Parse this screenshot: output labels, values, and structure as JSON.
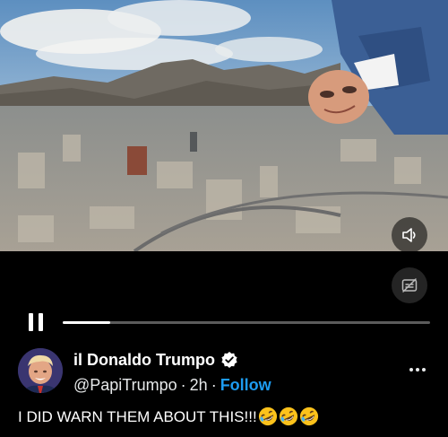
{
  "video": {
    "sound_icon": "speaker-icon",
    "captions_icon": "captions-off-icon",
    "progress_fraction": 0.13
  },
  "controls": {
    "pause_icon": "pause-icon"
  },
  "post": {
    "display_name": "il Donaldo Trumpo",
    "verified_icon": "verified-badge-icon",
    "handle": "@PapiTrumpo",
    "separator": "·",
    "time": "2h",
    "follow_label": "Follow",
    "more_icon": "more-options-icon",
    "text": "I DID WARN THEM ABOUT THIS!!!",
    "emoji": [
      "rofl-emoji",
      "rofl-emoji",
      "rofl-emoji"
    ]
  },
  "colors": {
    "background": "#000000",
    "link": "#1d9bf0",
    "progress_track": "#5b5b5b"
  }
}
